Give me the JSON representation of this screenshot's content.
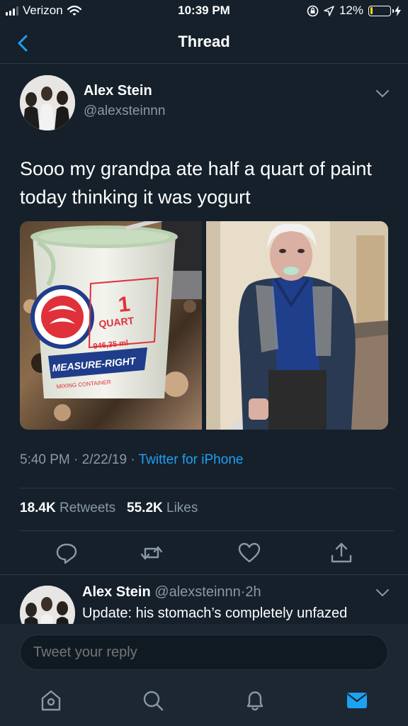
{
  "status_bar": {
    "carrier": "Verizon",
    "time": "10:39 PM",
    "battery_text": "12%",
    "battery_fraction": 0.12,
    "battery_color": "#ffd60a",
    "icons": [
      "signal-bars",
      "wifi-icon",
      "orientation-lock-icon",
      "location-arrow-icon",
      "battery-icon",
      "charging-bolt-icon"
    ]
  },
  "nav": {
    "title": "Thread",
    "back_icon": "chevron-left-icon"
  },
  "tweet": {
    "author_name": "Alex Stein",
    "author_handle": "@alexsteinnn",
    "text": "Sooo my grandpa ate half a quart of paint today thinking it was yogurt",
    "photos": [
      {
        "subject": "paint-bucket",
        "lettering": [
          "1",
          "QUART",
          "946,35 ml",
          "MEASURE-RIGHT",
          "MIXING CONTAINER"
        ]
      },
      {
        "subject": "grandpa-photo"
      }
    ],
    "time": "5:40 PM",
    "date": "2/22/19",
    "source": "Twitter for iPhone",
    "separator": "·",
    "retweets_count": "18.4K",
    "retweets_label": "Retweets",
    "likes_count": "55.2K",
    "likes_label": "Likes",
    "actions": [
      "reply-icon",
      "retweet-icon",
      "like-icon",
      "share-icon"
    ]
  },
  "reply": {
    "author_name": "Alex Stein",
    "author_handle": "@alexsteinnn",
    "separator": "·",
    "time_ago": "2h",
    "text": "Update: his stomach’s completely unfazed"
  },
  "compose": {
    "placeholder": "Tweet your reply"
  },
  "tab_bar": {
    "tabs": [
      "home-icon",
      "search-icon",
      "notifications-icon",
      "messages-icon"
    ],
    "active": "messages-icon"
  },
  "colors": {
    "background": "#15202b",
    "accent": "#1da1f2",
    "secondary_text": "#8899a6",
    "divider": "#2b3a48"
  }
}
